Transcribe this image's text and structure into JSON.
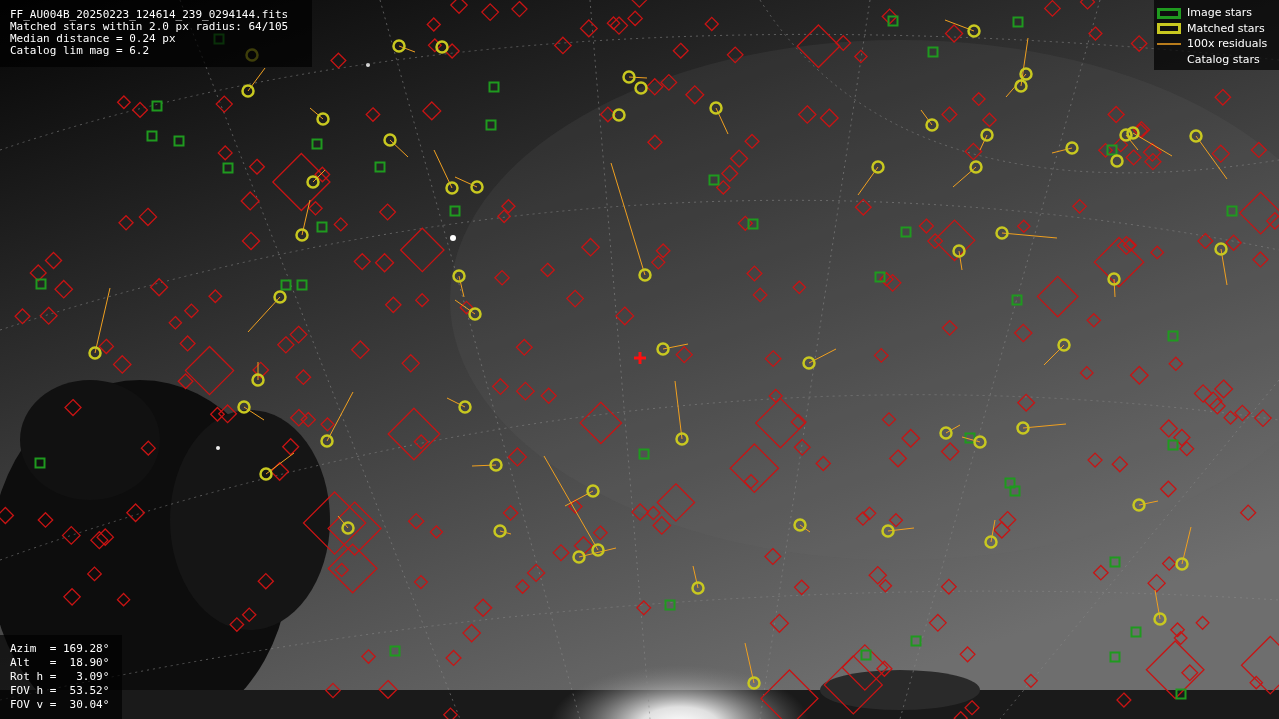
{
  "info_lines": [
    "FF_AU004B_20250223_124614_239_0294144.fits",
    "Matched stars within 2.0 px radius: 64/105",
    "Median distance = 0.24 px",
    "Catalog lim mag = 6.2"
  ],
  "legend": [
    {
      "label": "Image stars"
    },
    {
      "label": "Matched stars",
      "kind": "matched"
    },
    {
      "label": "100x residuals",
      "kind": "residual"
    },
    {
      "label": "Catalog stars",
      "kind": "catalog"
    }
  ],
  "pointing": [
    "Azim  = 169.28°",
    "Alt   =  18.90°",
    "Rot h =   3.09°",
    "FOV h =  53.52°",
    "FOV v =  30.04°"
  ]
}
